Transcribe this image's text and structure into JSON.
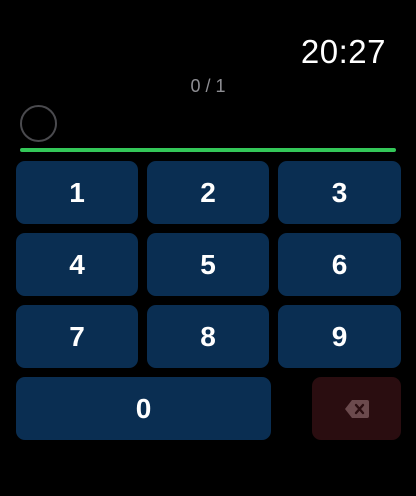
{
  "status_bar": {
    "time": "20:27"
  },
  "passcode": {
    "progress_text": "0 / 1",
    "entered_digits": 0,
    "total_digits": 1,
    "accent_color": "#34c759"
  },
  "keypad": {
    "keys": [
      "1",
      "2",
      "3",
      "4",
      "5",
      "6",
      "7",
      "8",
      "9"
    ],
    "zero": "0",
    "delete_icon": "backspace-icon",
    "key_color": "#0a2e52",
    "delete_color": "#2a0d10"
  }
}
